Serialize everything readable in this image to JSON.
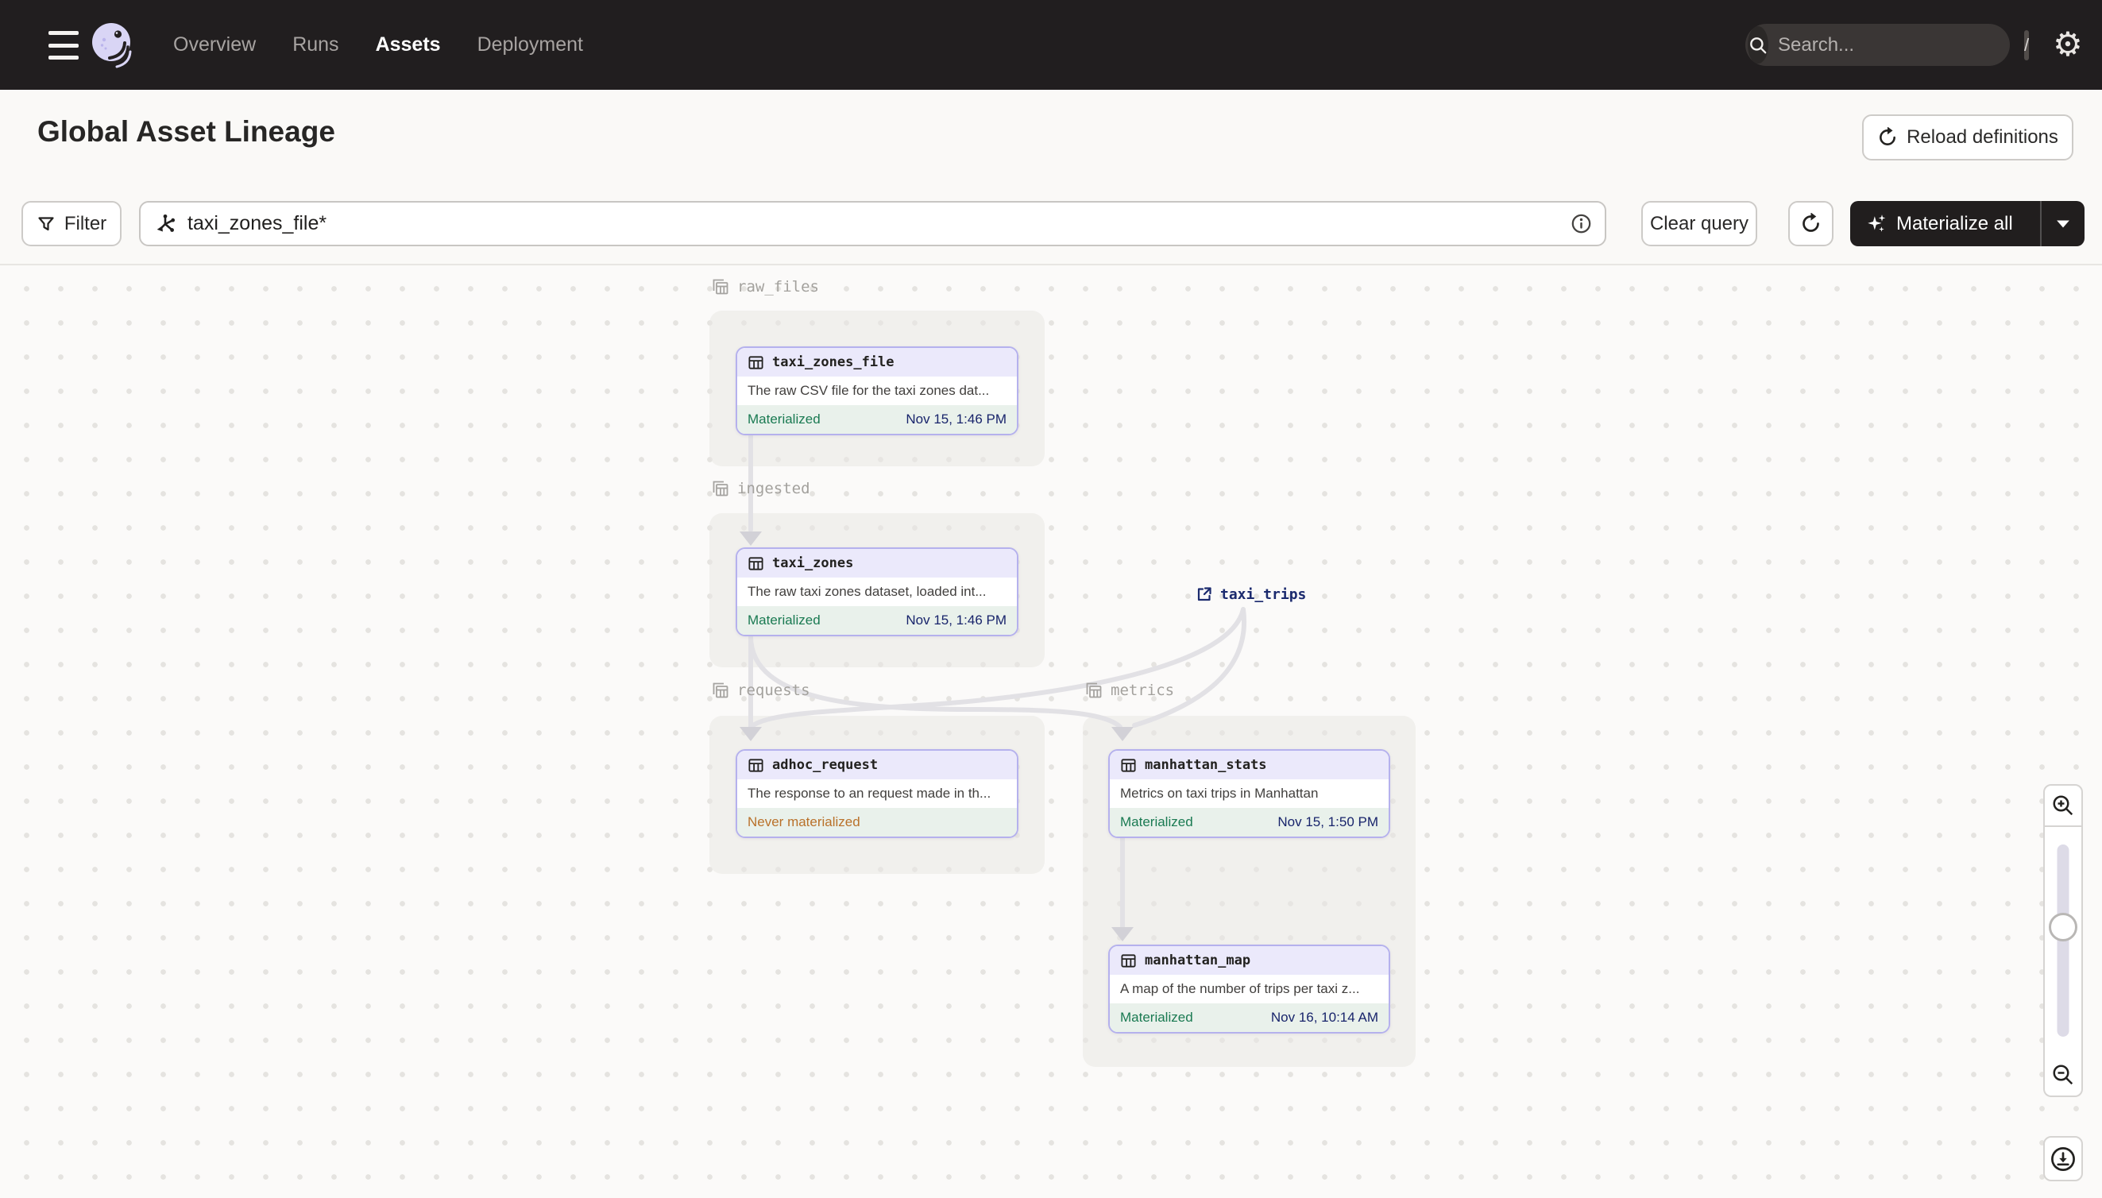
{
  "nav": {
    "tabs": [
      {
        "label": "Overview",
        "active": false
      },
      {
        "label": "Runs",
        "active": false
      },
      {
        "label": "Assets",
        "active": true
      },
      {
        "label": "Deployment",
        "active": false
      }
    ],
    "search": {
      "placeholder": "Search...",
      "shortcut": "/"
    }
  },
  "header": {
    "title": "Global Asset Lineage",
    "reload_button": "Reload definitions"
  },
  "toolbar": {
    "filter_button": "Filter",
    "query_value": "taxi_zones_file*",
    "clear_button": "Clear query",
    "materialize_button": "Materialize all"
  },
  "graph": {
    "groups": [
      {
        "name": "raw_files"
      },
      {
        "name": "ingested"
      },
      {
        "name": "requests"
      },
      {
        "name": "metrics"
      }
    ],
    "nodes": [
      {
        "name": "taxi_zones_file",
        "description": "The raw CSV file for the taxi zones dat...",
        "status": "Materialized",
        "timestamp": "Nov 15, 1:46 PM"
      },
      {
        "name": "taxi_zones",
        "description": "The raw taxi zones dataset, loaded int...",
        "status": "Materialized",
        "timestamp": "Nov 15, 1:46 PM"
      },
      {
        "name": "adhoc_request",
        "description": "The response to an request made in th...",
        "status": "Never materialized",
        "timestamp": ""
      },
      {
        "name": "manhattan_stats",
        "description": "Metrics on taxi trips in Manhattan",
        "status": "Materialized",
        "timestamp": "Nov 15, 1:50 PM"
      },
      {
        "name": "manhattan_map",
        "description": "A map of the number of trips per taxi z...",
        "status": "Materialized",
        "timestamp": "Nov 16, 10:14 AM"
      }
    ],
    "external_asset": {
      "name": "taxi_trips"
    }
  },
  "colors": {
    "nav_bg": "#211E1F",
    "accent_purple": "#B5B1ED",
    "materialized_green": "#1A7A52",
    "never_materialized_orange": "#B9712A",
    "timestamp_navy": "#18246B"
  }
}
